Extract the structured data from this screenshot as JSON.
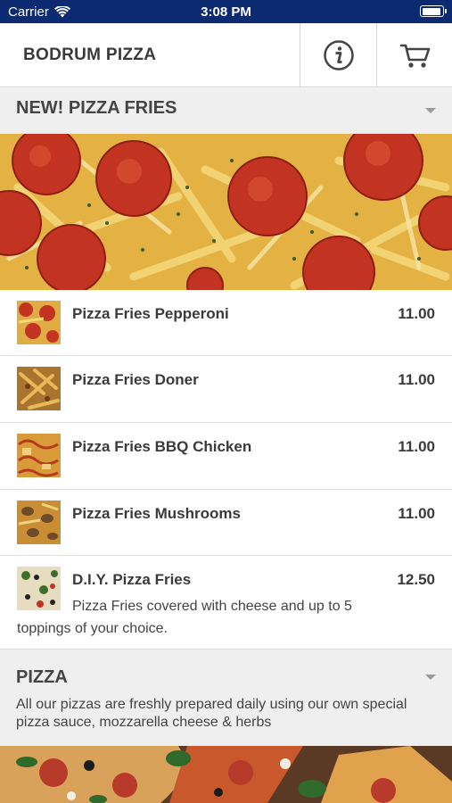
{
  "status_bar": {
    "carrier": "Carrier",
    "time": "3:08 PM",
    "battery_level": 0.95
  },
  "nav": {
    "title": "BODRUM PIZZA",
    "info_icon": "info-icon",
    "cart_icon": "cart-icon"
  },
  "sections": [
    {
      "title": "NEW! PIZZA FRIES",
      "description": ""
    },
    {
      "title": "PIZZA",
      "description": "All our pizzas are freshly prepared daily using our own special pizza sauce, mozzarella cheese & herbs"
    }
  ],
  "items": [
    {
      "name": "Pizza Fries Pepperoni",
      "price": "11.00",
      "description": ""
    },
    {
      "name": "Pizza Fries Doner",
      "price": "11.00",
      "description": ""
    },
    {
      "name": "Pizza Fries BBQ Chicken",
      "price": "11.00",
      "description": ""
    },
    {
      "name": "Pizza Fries Mushrooms",
      "price": "11.00",
      "description": ""
    },
    {
      "name": "D.I.Y. Pizza Fries",
      "price": "12.50",
      "description": "Pizza Fries covered with cheese and up to 5 toppings of your choice."
    }
  ],
  "colors": {
    "status_bar": "#0b2a6f",
    "section_bg": "#efefef",
    "text": "#3a3a3a"
  }
}
